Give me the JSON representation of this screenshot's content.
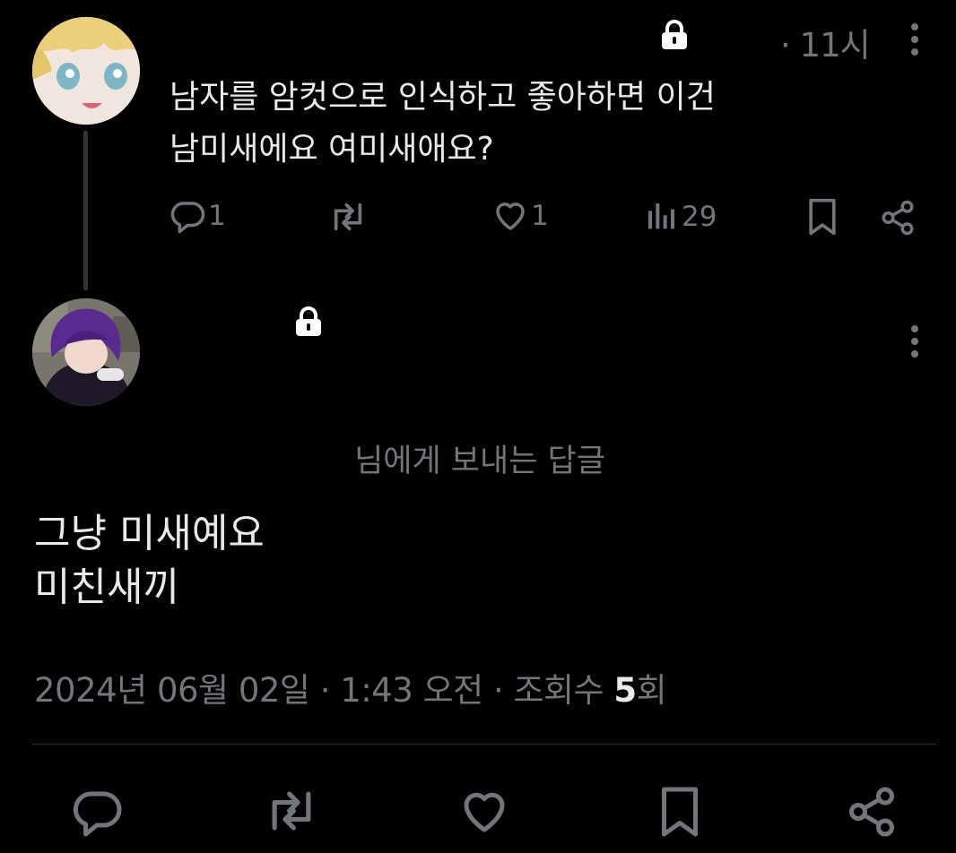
{
  "parent_tweet": {
    "time": "· 11시",
    "text_lines": [
      "남자를 암컷으로 인식하고 좋아하면 이건",
      "남미새에요 여미새애요?"
    ],
    "reply_count": "1",
    "like_count": "1",
    "view_count": "29"
  },
  "reply_tweet": {
    "replying_to": "님에게 보내는 답글",
    "text_lines": [
      "그냥 미새예요",
      "미친새끼"
    ],
    "meta_prefix": "2024년 06월 02일 · 1:43 오전 · 조회수 ",
    "view_count": "5",
    "meta_suffix": "회"
  },
  "icons": {
    "lock": "lock-icon",
    "more": "more-vertical-icon",
    "reply": "reply-icon",
    "retweet": "retweet-icon",
    "like": "heart-icon",
    "views": "views-icon",
    "bookmark": "bookmark-icon",
    "share": "share-icon"
  },
  "colors": {
    "background": "#000000",
    "text": "#e7e9ea",
    "muted": "#71767b",
    "divider": "#2f3336"
  }
}
